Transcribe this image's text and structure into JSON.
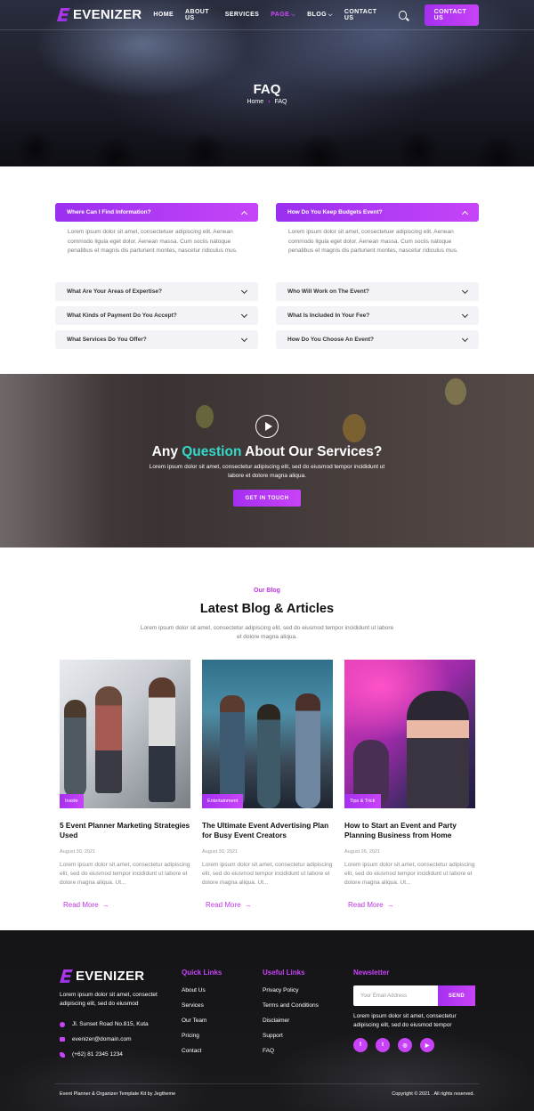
{
  "nav": {
    "brand": "EVENIZER",
    "items": [
      {
        "label": "HOME",
        "active": false,
        "dropdown": false
      },
      {
        "label": "ABOUT US",
        "active": false,
        "dropdown": false
      },
      {
        "label": "SERVICES",
        "active": false,
        "dropdown": false
      },
      {
        "label": "PAGE",
        "active": true,
        "dropdown": true
      },
      {
        "label": "BLOG",
        "active": false,
        "dropdown": true
      },
      {
        "label": "CONTACT US",
        "active": false,
        "dropdown": false
      }
    ],
    "cta": "CONTACT US"
  },
  "hero": {
    "title": "FAQ",
    "breadcrumb_home": "Home",
    "breadcrumb_current": "FAQ"
  },
  "faq": {
    "left": [
      {
        "q": "Where Can I Find Information?",
        "open": true,
        "a": "Lorem ipsum dolor sit amet, consectetuer adipiscing elit. Aenean commodo ligula eget dolor. Aenean massa. Cum sociis natoque penatibus et magnis dis parturient montes, nascetur ridiculus mus."
      },
      {
        "q": "What Are Your Areas of Expertise?",
        "open": false
      },
      {
        "q": "What Kinds of Payment Do You Accept?",
        "open": false
      },
      {
        "q": "What Services Do You Offer?",
        "open": false
      }
    ],
    "right": [
      {
        "q": "How Do You Keep Budgets Event?",
        "open": true,
        "a": "Lorem ipsum dolor sit amet, consectetuer adipiscing elit. Aenean commodo ligula eget dolor. Aenean massa. Cum sociis natoque penatibus et magnis dis parturient montes, nascetur ridiculus mus."
      },
      {
        "q": "Who Will Work on The Event?",
        "open": false
      },
      {
        "q": "What Is Included In Your Fee?",
        "open": false
      },
      {
        "q": "How Do You Choose An Event?",
        "open": false
      }
    ]
  },
  "cta": {
    "title_pre": "Any ",
    "title_hl": "Question",
    "title_post": " About Our Services?",
    "text": "Lorem ipsum dolor sit amet, consectetur adipiscing elit, sed do eiusmod tempor incididunt ut labore et dolore magna aliqua.",
    "button": "GET IN TOUCH"
  },
  "blog": {
    "kicker": "Our Blog",
    "title": "Latest Blog & Articles",
    "intro": "Lorem ipsum dolor sit amet, consectetur adipiscing elit, sed do eiusmod tempor incididunt ut labore et dolore magna aliqua.",
    "posts": [
      {
        "tag": "Inside",
        "title": "5 Event Planner Marketing Strategies Used",
        "date": "August 30, 2021",
        "excerpt": "Lorem ipsum dolor sit amet, consectetur adipiscing elit, sed do eiusmod tempor incididunt ut labore et dolore magna aliqua. Ut...",
        "more": "Read More"
      },
      {
        "tag": "Entertainment",
        "title": "The Ultimate Event Advertising Plan for Busy Event Creators",
        "date": "August 30, 2021",
        "excerpt": "Lorem ipsum dolor sit amet, consectetur adipiscing elit, sed do eiusmod tempor incididunt ut labore et dolore magna aliqua. Ut...",
        "more": "Read More"
      },
      {
        "tag": "Tips & Trick",
        "title": "How to Start an Event and Party Planning Business from Home",
        "date": "August 26, 2021",
        "excerpt": "Lorem ipsum dolor sit amet, consectetur adipiscing elit, sed do eiusmod tempor incididunt ut labore et dolore magna aliqua. Ut...",
        "more": "Read More"
      }
    ]
  },
  "footer": {
    "brand": "EVENIZER",
    "about": "Lorem ipsum dolor sit amet, consectet adipiscing elit, sed do eiusmod",
    "address": "Jl. Sunset Road No.815, Kuta",
    "email": "evenizer@domain.com",
    "phone": "(+62) 81 2345 1234",
    "quick_title": "Quick Links",
    "quick_links": [
      "About Us",
      "Services",
      "Our Team",
      "Pricing",
      "Contact"
    ],
    "useful_title": "Useful Links",
    "useful_links": [
      "Privacy Policy",
      "Terms and Conditions",
      "Disclaimer",
      "Support",
      "FAQ"
    ],
    "newsletter_title": "Newsletter",
    "email_placeholder": "Your Email Address",
    "send": "SEND",
    "newsletter_text": "Lorem ipsum dolor sit amet, consectetur adipiscing elit, sed do eiusmod tempor",
    "social": [
      "facebook-icon",
      "twitter-icon",
      "instagram-icon",
      "youtube-icon"
    ],
    "credit": "Event Planner & Organizer Template Kit by Jegtheme",
    "copyright": "Copyright © 2021 . All rights reserved."
  },
  "colors": {
    "accent": "#c843f7",
    "accent_dark": "#a52ff0",
    "highlight": "#34d9c9"
  }
}
